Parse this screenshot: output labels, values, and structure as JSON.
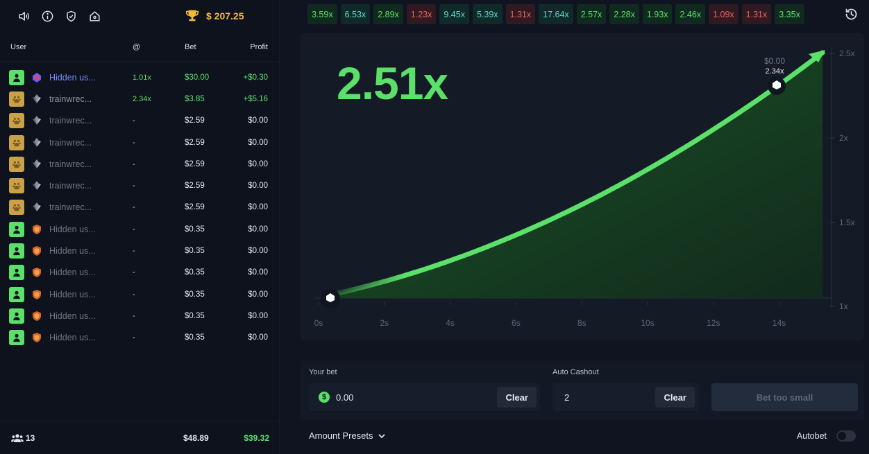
{
  "topbar": {
    "icons": [
      "speaker-icon",
      "info-icon",
      "shield-check-icon",
      "home-icon"
    ],
    "balance": "$ 207.25"
  },
  "table": {
    "headers": {
      "user": "User",
      "at": "@",
      "bet": "Bet",
      "profit": "Profit"
    },
    "rows": [
      {
        "avatar": "green",
        "badge": "gem-badge-icon",
        "name": "Hidden us...",
        "at": "1.01x",
        "bet": "$30.00",
        "profit": "+$0.30",
        "win": true,
        "active": true
      },
      {
        "avatar": "gold",
        "badge": "crystal-badge-icon",
        "name": "trainwrec...",
        "at": "2.34x",
        "bet": "$3.85",
        "profit": "+$5.16",
        "win": true
      },
      {
        "avatar": "gold",
        "badge": "crystal-badge-icon",
        "name": "trainwrec...",
        "at": "-",
        "bet": "$2.59",
        "profit": "$0.00"
      },
      {
        "avatar": "gold",
        "badge": "crystal-badge-icon",
        "name": "trainwrec...",
        "at": "-",
        "bet": "$2.59",
        "profit": "$0.00"
      },
      {
        "avatar": "gold",
        "badge": "crystal-badge-icon",
        "name": "trainwrec...",
        "at": "-",
        "bet": "$2.59",
        "profit": "$0.00"
      },
      {
        "avatar": "gold",
        "badge": "crystal-badge-icon",
        "name": "trainwrec...",
        "at": "-",
        "bet": "$2.59",
        "profit": "$0.00"
      },
      {
        "avatar": "gold",
        "badge": "crystal-badge-icon",
        "name": "trainwrec...",
        "at": "-",
        "bet": "$2.59",
        "profit": "$0.00"
      },
      {
        "avatar": "green",
        "badge": "bronze-shield-badge-icon",
        "name": "Hidden us...",
        "at": "-",
        "bet": "$0.35",
        "profit": "$0.00"
      },
      {
        "avatar": "green",
        "badge": "bronze-shield-badge-icon",
        "name": "Hidden us...",
        "at": "-",
        "bet": "$0.35",
        "profit": "$0.00"
      },
      {
        "avatar": "green",
        "badge": "bronze-shield-badge-icon",
        "name": "Hidden us...",
        "at": "-",
        "bet": "$0.35",
        "profit": "$0.00"
      },
      {
        "avatar": "green",
        "badge": "bronze-shield-badge-icon",
        "name": "Hidden us...",
        "at": "-",
        "bet": "$0.35",
        "profit": "$0.00"
      },
      {
        "avatar": "green",
        "badge": "bronze-shield-badge-icon",
        "name": "Hidden us...",
        "at": "-",
        "bet": "$0.35",
        "profit": "$0.00"
      },
      {
        "avatar": "green",
        "badge": "bronze-shield-badge-icon",
        "name": "Hidden us...",
        "at": "-",
        "bet": "$0.35",
        "profit": "$0.00"
      }
    ],
    "footer": {
      "players": "13",
      "total_bet": "$48.89",
      "total_profit": "$39.32"
    }
  },
  "history": [
    {
      "v": "3.59x",
      "c": "g"
    },
    {
      "v": "6.53x",
      "c": "t"
    },
    {
      "v": "2.89x",
      "c": "g"
    },
    {
      "v": "1.23x",
      "c": "r"
    },
    {
      "v": "9.45x",
      "c": "t"
    },
    {
      "v": "5.39x",
      "c": "t"
    },
    {
      "v": "1.31x",
      "c": "r"
    },
    {
      "v": "17.64x",
      "c": "t"
    },
    {
      "v": "2.57x",
      "c": "g"
    },
    {
      "v": "2.28x",
      "c": "g"
    },
    {
      "v": "1.93x",
      "c": "g"
    },
    {
      "v": "2.46x",
      "c": "g"
    },
    {
      "v": "1.09x",
      "c": "r"
    },
    {
      "v": "1.31x",
      "c": "r"
    },
    {
      "v": "3.35x",
      "c": "g"
    }
  ],
  "graph": {
    "multiplier": "2.51x",
    "x_ticks": [
      "0s",
      "2s",
      "4s",
      "6s",
      "8s",
      "10s",
      "12s",
      "14s"
    ],
    "y_ticks": [
      "2.5x",
      "2x",
      "1.5x",
      "1x"
    ],
    "cashout_marker": {
      "amount": "$0.00",
      "mult": "2.34x"
    },
    "colors": {
      "line": "#5be06a",
      "fill": "#1f5a2b"
    }
  },
  "bet": {
    "your_bet_label": "Your bet",
    "your_bet_value": "0.00",
    "clear_label": "Clear",
    "auto_cashout_label": "Auto Cashout",
    "auto_cashout_value": "2",
    "bet_button": "Bet too small",
    "presets_label": "Amount Presets",
    "autobet_label": "Autobet"
  }
}
